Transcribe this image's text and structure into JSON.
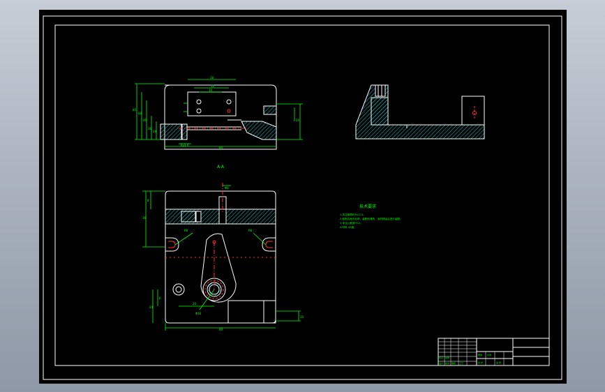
{
  "colors": {
    "background": "#000000",
    "frame": "#ffffff",
    "outline": "#ffffff",
    "dimension": "#00ff00",
    "hatch": "#00d4d4",
    "centerline": "#ff3030",
    "notes": "#00ff00"
  },
  "views": {
    "top_label": "A-A"
  },
  "notes": {
    "title": "技术要求",
    "lines": [
      "1.未注倒角均为C0.5。",
      "2.各配合面去毛刺，装配前清洗，涂防锈油后进行装配。",
      "3.未注公差按IT12。",
      "4.材料 45钢。"
    ]
  },
  "dimensions": [
    "80",
    "60",
    "45",
    "36",
    "24",
    "20",
    "18",
    "12",
    "10",
    "8",
    "6",
    "Ra1.6",
    "R6",
    "Φ8",
    "Φ16"
  ],
  "title_block": {
    "rows": [
      "标记",
      "处数",
      "设计",
      "校对",
      "审核",
      "工艺"
    ],
    "fields": [
      "重量",
      "比例",
      "共 张",
      "第 张"
    ]
  }
}
